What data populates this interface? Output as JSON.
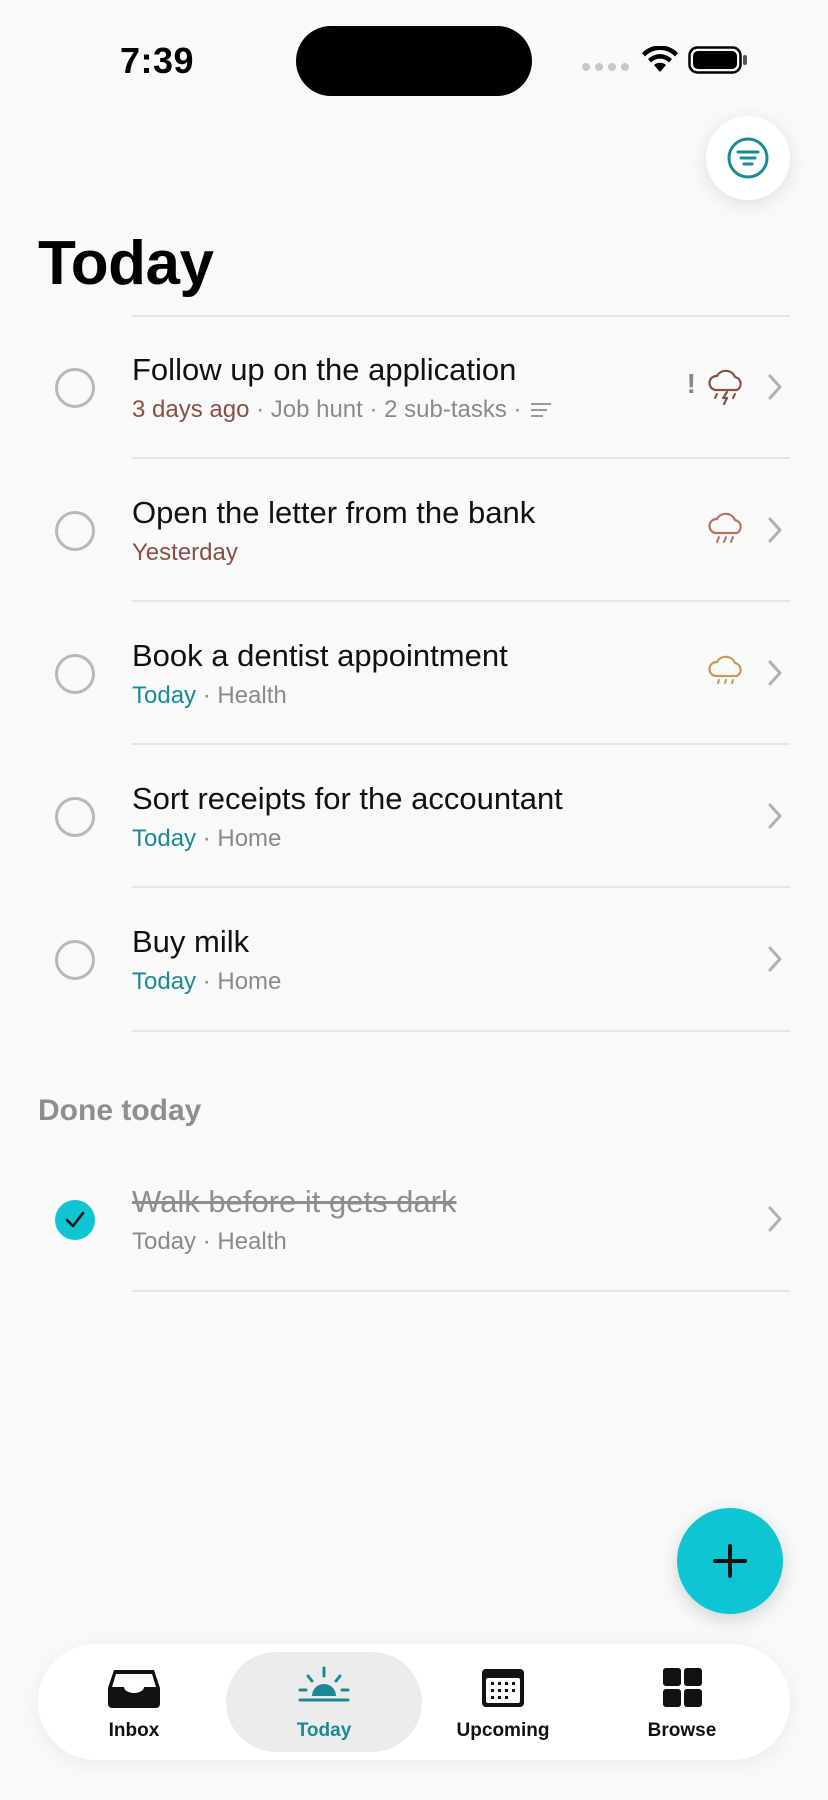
{
  "status_bar": {
    "time": "7:39"
  },
  "page": {
    "title": "Today"
  },
  "tasks": [
    {
      "title": "Follow up on the application",
      "date": "3 days ago",
      "date_kind": "past",
      "project": "Job hunt",
      "extra": "2 sub-tasks",
      "has_notes": true,
      "priority": "!",
      "weather": "thunderstorm"
    },
    {
      "title": "Open the letter from the bank",
      "date": "Yesterday",
      "date_kind": "past",
      "weather": "rain"
    },
    {
      "title": "Book a dentist appointment",
      "date": "Today",
      "date_kind": "today",
      "project": "Health",
      "weather": "light-rain"
    },
    {
      "title": "Sort receipts for the accountant",
      "date": "Today",
      "date_kind": "today",
      "project": "Home"
    },
    {
      "title": "Buy milk",
      "date": "Today",
      "date_kind": "today",
      "project": "Home"
    }
  ],
  "done_section": {
    "header": "Done today",
    "tasks": [
      {
        "title": "Walk before it gets dark",
        "date": "Today",
        "project": "Health",
        "completed": true
      }
    ]
  },
  "separator": " · ",
  "tab_bar": {
    "tabs": [
      {
        "label": "Inbox",
        "icon": "inbox-icon",
        "active": false
      },
      {
        "label": "Today",
        "icon": "sunrise-icon",
        "active": true
      },
      {
        "label": "Upcoming",
        "icon": "calendar-icon",
        "active": false
      },
      {
        "label": "Browse",
        "icon": "grid-icon",
        "active": false
      }
    ]
  },
  "colors": {
    "accent": "#10c5d3",
    "accent_text": "#1a8a96",
    "overdue": "#8a4f44",
    "weather_storm": "#8a4f44",
    "weather_rain": "#b5745a",
    "weather_light": "#c79a55",
    "background": "#f8f9f9"
  }
}
